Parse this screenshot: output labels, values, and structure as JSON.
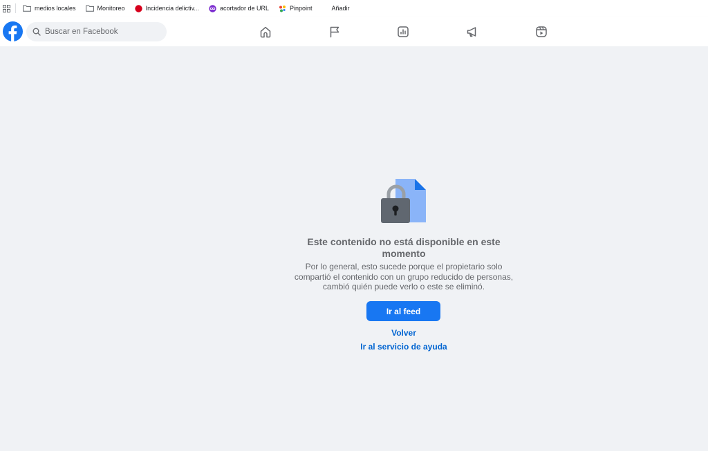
{
  "bookmarks": [
    {
      "label": "medios locales",
      "icon": "folder-icon"
    },
    {
      "label": "Monitoreo",
      "icon": "folder-icon"
    },
    {
      "label": "Incidencia delictiv...",
      "icon": "red-dot-icon"
    },
    {
      "label": "acortador de URL",
      "icon": "link-shortener-icon"
    },
    {
      "label": "Pinpoint",
      "icon": "pinpoint-icon"
    },
    {
      "label": "Añadir",
      "icon": ""
    }
  ],
  "header": {
    "search_placeholder": "Buscar en Facebook",
    "nav": [
      "home-icon",
      "flag-icon",
      "chart-icon",
      "megaphone-icon",
      "reels-icon"
    ]
  },
  "message": {
    "title": "Este contenido no está disponible en este momento",
    "description": "Por lo general, esto sucede porque el propietario solo compartió el contenido con un grupo reducido de personas, cambió quién puede verlo o este se eliminó.",
    "primary_button": "Ir al feed",
    "back_link": "Volver",
    "help_link": "Ir al servicio de ayuda"
  },
  "colors": {
    "brand": "#1877f2",
    "link": "#0064d1",
    "background": "#f0f2f5"
  }
}
